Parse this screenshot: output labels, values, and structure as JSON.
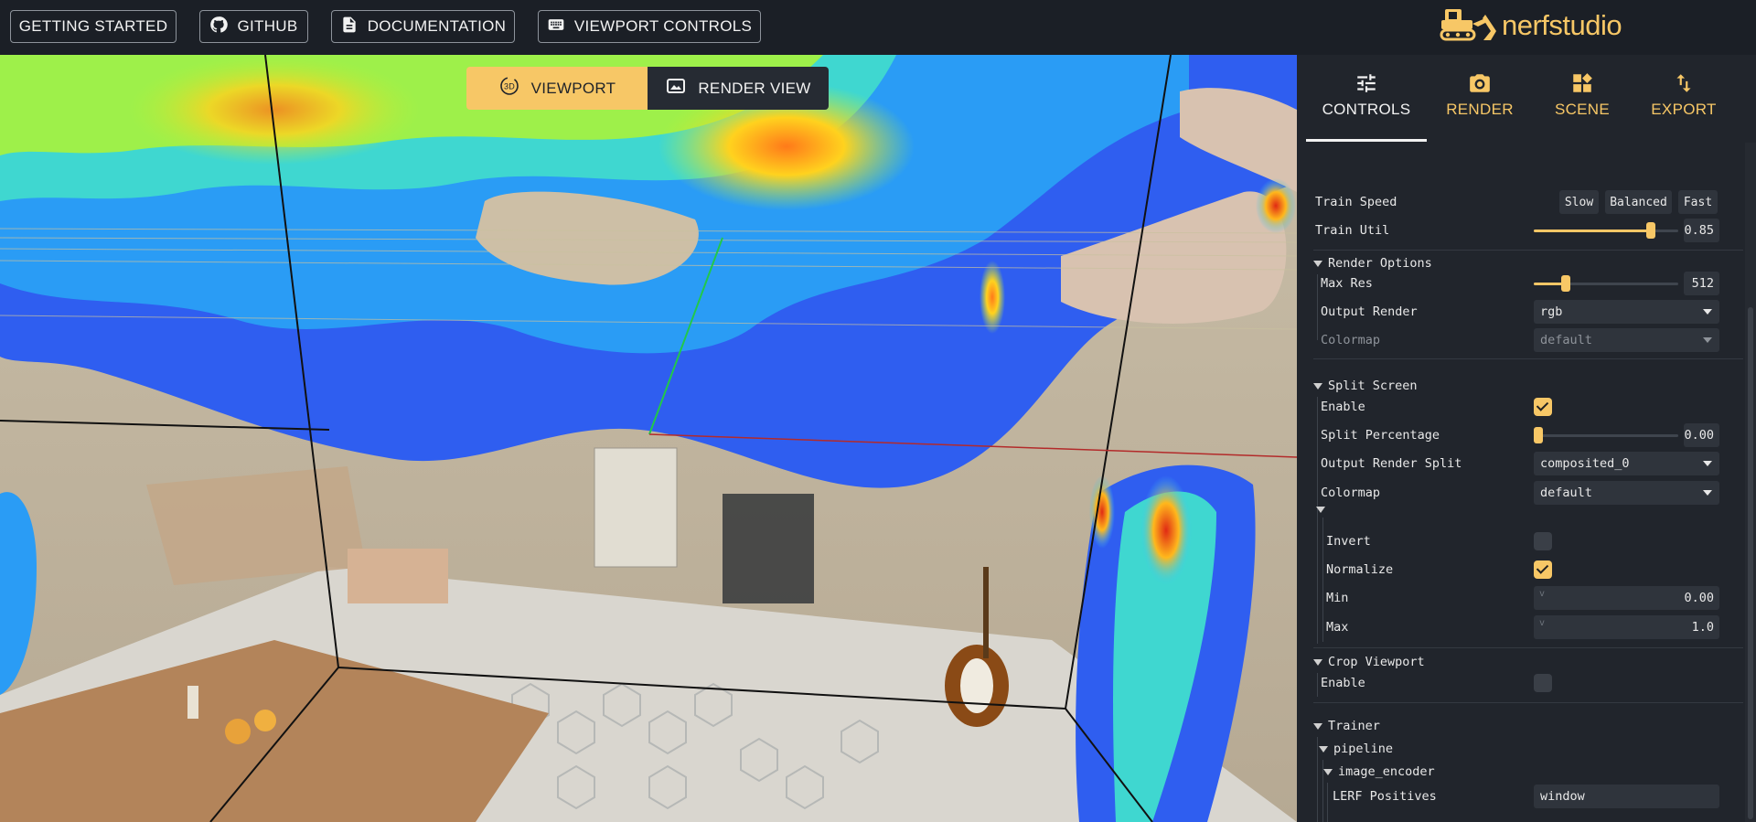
{
  "topbar": {
    "getting_started": "GETTING STARTED",
    "github": "GITHUB",
    "documentation": "DOCUMENTATION",
    "viewport_controls": "VIEWPORT CONTROLS",
    "logo_text": "nerfstudio"
  },
  "viewport": {
    "toggle_viewport": "VIEWPORT",
    "toggle_viewport_badge": "3D",
    "toggle_render_view": "RENDER VIEW",
    "active": "viewport"
  },
  "tabs": [
    {
      "label": "CONTROLS",
      "icon": "sliders-icon",
      "active": true
    },
    {
      "label": "RENDER",
      "icon": "camera-icon",
      "active": false
    },
    {
      "label": "SCENE",
      "icon": "scene-icon",
      "active": false
    },
    {
      "label": "EXPORT",
      "icon": "export-icon",
      "active": false
    }
  ],
  "controls": {
    "train_speed": {
      "label": "Train Speed",
      "options": [
        "Slow",
        "Balanced",
        "Fast"
      ]
    },
    "train_util": {
      "label": "Train Util",
      "value": "0.85",
      "fraction": 0.85
    },
    "render_options": {
      "title": "Render Options",
      "max_res": {
        "label": "Max Res",
        "value": "512",
        "fraction": 0.25
      },
      "output_render": {
        "label": "Output Render",
        "value": "rgb"
      },
      "colormap": {
        "label": "Colormap",
        "value": "default",
        "disabled": true
      }
    },
    "split_screen": {
      "title": "Split Screen",
      "enable": {
        "label": "Enable",
        "checked": true
      },
      "split_percentage": {
        "label": "Split Percentage",
        "value": "0.00",
        "fraction": 0.0
      },
      "output_render_split": {
        "label": "Output Render Split",
        "value": "composited_0"
      },
      "colormap": {
        "label": "Colormap",
        "value": "default"
      },
      "invert": {
        "label": "Invert",
        "checked": false
      },
      "normalize": {
        "label": "Normalize",
        "checked": true
      },
      "min": {
        "label": "Min",
        "prefix": "v",
        "value": "0.00"
      },
      "max": {
        "label": "Max",
        "prefix": "v",
        "value": "1.0"
      }
    },
    "crop_viewport": {
      "title": "Crop Viewport",
      "enable": {
        "label": "Enable",
        "checked": false
      }
    },
    "trainer": {
      "title": "Trainer",
      "pipeline": "pipeline",
      "image_encoder": "image_encoder",
      "lerf_positives": {
        "label": "LERF Positives",
        "value": "window"
      }
    }
  },
  "colors": {
    "accent": "#f7c766",
    "panel_bg": "#21252c",
    "topbar_bg": "#1b1f26",
    "input_bg": "#2f343c"
  }
}
